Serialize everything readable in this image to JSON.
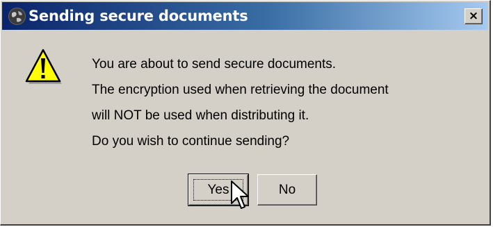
{
  "dialog": {
    "title": "Sending secure documents",
    "close_label": "×",
    "message_lines": [
      "You are about to send secure documents.",
      "The encryption used when retrieving the document",
      "will NOT be used when distributing it.",
      "Do you wish to continue sending?"
    ],
    "buttons": {
      "yes": "Yes",
      "no": "No"
    },
    "icons": {
      "title": "globe-icon",
      "warning": "warning-icon",
      "cursor": "mouse-cursor-icon"
    },
    "colors": {
      "titlebar_start": "#0a246a",
      "titlebar_end": "#a6caf0",
      "face": "#d4d0c8",
      "warning": "#ffff00"
    }
  }
}
